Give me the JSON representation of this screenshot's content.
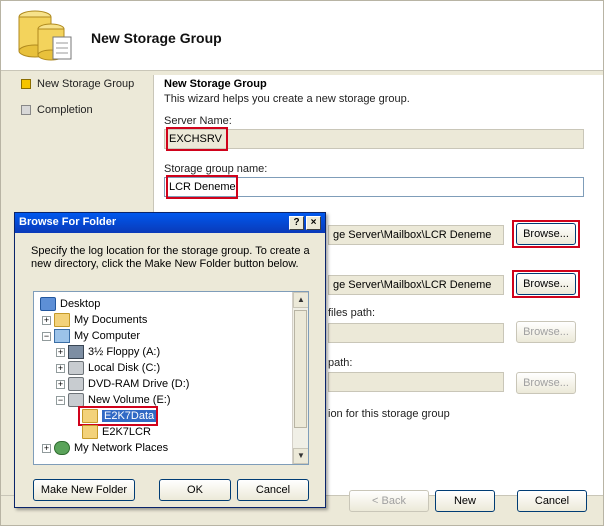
{
  "wizard": {
    "title": "New Storage Group",
    "steps": [
      {
        "label": "New Storage Group",
        "active": true
      },
      {
        "label": "Completion",
        "active": false
      }
    ],
    "content": {
      "heading": "New Storage Group",
      "description": "This wizard helps you create a new storage group.",
      "server_name_label": "Server Name:",
      "server_name_value": "EXCHSRV",
      "sg_name_label": "Storage group name:",
      "sg_name_value": "LCR Deneme",
      "log_path_fragment": "ge Server\\Mailbox\\LCR Deneme",
      "system_path_fragment": "ge Server\\Mailbox\\LCR Deneme",
      "browse_label": "Browse...",
      "files_path_fragment": "files path:",
      "path_fragment": "path:",
      "enable_fragment": "ion for this storage group"
    },
    "footer": {
      "back_label": "< Back",
      "next_label": "New",
      "cancel_label": "Cancel"
    }
  },
  "dialog": {
    "title": "Browse For Folder",
    "help_label": "?",
    "close_label": "×",
    "description": "Specify the log location for the storage group. To create a new directory, click the Make New Folder button below.",
    "tree": [
      {
        "label": "Desktop",
        "icon": "desktop-icon",
        "indent": 0,
        "expander": ""
      },
      {
        "label": "My Documents",
        "icon": "folder-icon",
        "indent": 1,
        "expander": "+"
      },
      {
        "label": "My Computer",
        "icon": "computer-icon",
        "indent": 1,
        "expander": "−"
      },
      {
        "label": "3½ Floppy (A:)",
        "icon": "floppy-icon",
        "indent": 2,
        "expander": "+"
      },
      {
        "label": "Local Disk (C:)",
        "icon": "drive-icon",
        "indent": 2,
        "expander": "+"
      },
      {
        "label": "DVD-RAM Drive (D:)",
        "icon": "drive-icon",
        "indent": 2,
        "expander": "+"
      },
      {
        "label": "New Volume (E:)",
        "icon": "drive-icon",
        "indent": 2,
        "expander": "−"
      },
      {
        "label": "E2K7Data",
        "icon": "folder-icon",
        "indent": 3,
        "expander": "",
        "selected": true
      },
      {
        "label": "E2K7LCR",
        "icon": "folder-icon",
        "indent": 3,
        "expander": ""
      },
      {
        "label": "My Network Places",
        "icon": "network-icon",
        "indent": 1,
        "expander": "+"
      }
    ],
    "make_new_folder_label": "Make New Folder",
    "ok_label": "OK",
    "cancel_label": "Cancel"
  }
}
